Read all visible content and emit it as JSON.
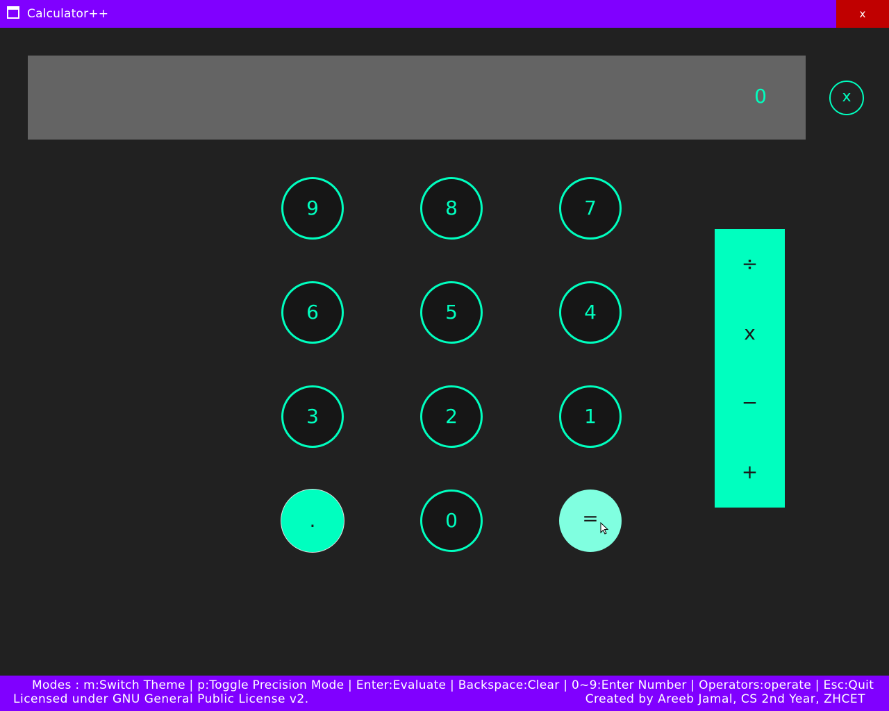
{
  "window": {
    "title": "Calculator++",
    "close_label": "x"
  },
  "display": {
    "value": "0",
    "clear_label": "x"
  },
  "keys": {
    "k9": "9",
    "k8": "8",
    "k7": "7",
    "k6": "6",
    "k5": "5",
    "k4": "4",
    "k3": "3",
    "k2": "2",
    "k1": "1",
    "dot": ".",
    "k0": "0",
    "equals": "="
  },
  "operators": {
    "divide": "÷",
    "multiply": "x",
    "subtract": "−",
    "add": "+"
  },
  "footer": {
    "shortcuts": "Modes : m:Switch Theme | p:Toggle Precision Mode | Enter:Evaluate | Backspace:Clear | 0~9:Enter Number | Operators:operate | Esc:Quit",
    "license": "Licensed under GNU General Public License v2.",
    "credits": "Created by Areeb Jamal,  CS 2nd Year,  ZHCET"
  },
  "colors": {
    "accent": "#00ffbf",
    "titlebar": "#8000ff",
    "background": "#212121",
    "display": "#646464",
    "close": "#c00000"
  }
}
